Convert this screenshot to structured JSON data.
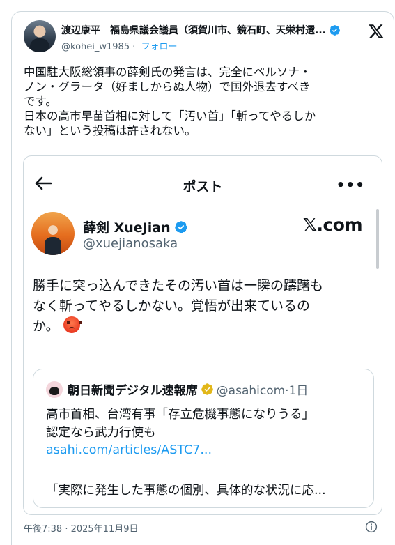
{
  "tweet": {
    "author_name": "渡辺康平　福島県議会議員（須賀川市、鏡石町、天栄村選...",
    "handle": "@kohei_w1985",
    "follow_label": "フォロー",
    "separator": "·",
    "body": "中国駐大阪総領事の薛剣氏の発言は、完全にペルソナ・\nノン・グラータ（好ましからぬ人物）で国外退去すべき\nです。\n日本の高市早苗首相に対して「汚い首」「斬ってやるしか\nない」という投稿は許されない。",
    "timestamp": "午後7:38 · 2025年11月9日",
    "icons": {
      "verified": "verified-badge-icon",
      "platform": "x-logo-icon",
      "info": "info-icon"
    },
    "colors": {
      "accent": "#1d9bf0",
      "muted": "#536471",
      "border": "#cfd9de"
    }
  },
  "screenshot": {
    "bar_title": "ポスト",
    "more_label": "•••",
    "author_name": "薛剣 XueJian",
    "handle": "@xuejianosaka",
    "watermark": "𝕏.com",
    "body": "勝手に突っ込んできたその汚い首は一瞬の躊躇も\nなく斬ってやるしかない。覚悟が出来ているの\nか。",
    "emoji": "angry-face-icon",
    "quote": {
      "name": "朝日新聞デジタル速報席",
      "handle_time": "@asahicom·1日",
      "text": "高市首相、台湾有事「存立危機事態になりうる」\n認定なら武力行使も",
      "link": "asahi.com/articles/ASTC7...",
      "snippet": "「実際に発生した事態の個別、具体的な状況に応..."
    }
  }
}
